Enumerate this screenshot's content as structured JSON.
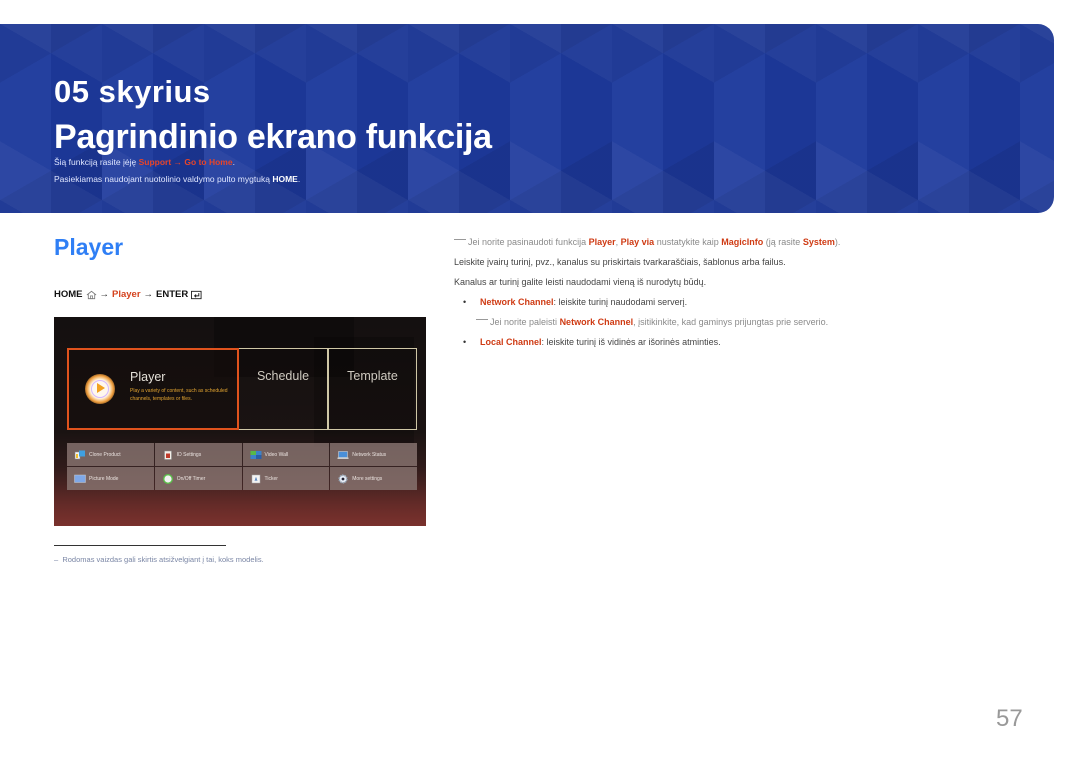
{
  "header": {
    "chapter": "05 skyrius",
    "title": "Pagrindinio ekrano funkcija",
    "location_prefix": "Šią funkciją rasite įėję",
    "location_menu1": "Support",
    "location_arrow": "→",
    "location_menu2": "Go to Home",
    "location_suffix": ".",
    "remote_prefix": "Pasiekiamas naudojant nuotolinio valdymo pulto mygtuką",
    "remote_button": "HOME",
    "remote_suffix": "."
  },
  "section": {
    "title": "Player",
    "path": {
      "home": "HOME",
      "home_icon": "home-icon",
      "arrow1": "→",
      "player": "Player",
      "arrow2": "→",
      "enter": "ENTER",
      "enter_icon": "enter-icon"
    }
  },
  "screen": {
    "tiles": [
      {
        "label": "Player",
        "desc": "Play a variety of content, such as scheduled channels, templates or files.",
        "icon": "play-icon",
        "selected": true
      },
      {
        "label": "Schedule"
      },
      {
        "label": "Template"
      }
    ],
    "grid": [
      {
        "label": "Clone Product",
        "icon": "clone-product-icon"
      },
      {
        "label": "ID Settings",
        "icon": "id-settings-icon"
      },
      {
        "label": "Video Wall",
        "icon": "video-wall-icon"
      },
      {
        "label": "Network Status",
        "icon": "network-status-icon"
      },
      {
        "label": "Picture Mode",
        "icon": "picture-mode-icon"
      },
      {
        "label": "On/Off Timer",
        "icon": "timer-icon"
      },
      {
        "label": "Ticker",
        "icon": "ticker-icon"
      },
      {
        "label": "More settings",
        "icon": "gear-icon"
      }
    ],
    "accent": "#e0531d"
  },
  "footnote": "Rodomas vaizdas gali skirtis atsižvelgiant į tai, koks modelis.",
  "right": {
    "note1": {
      "prefix": "Jei norite pasinaudoti funkcija",
      "k1": "Player",
      "sep": ",",
      "k2": "Play via",
      "mid": "nustatykite kaip",
      "k3": "MagicInfo",
      "paren_open": "(ją rasite",
      "k4": "System",
      "paren_close": ")."
    },
    "para1": "Leiskite įvairų turinį, pvz., kanalus su priskirtais tvarkaraščiais, šablonus arba failus.",
    "para2": "Kanalus ar turinį galite leisti naudodami vieną iš nurodytų būdų.",
    "bullets": [
      {
        "term": "Network Channel",
        "text": ": leiskite turinį naudodami serverį."
      },
      {
        "term": "Local Channel",
        "text": ": leiskite turinį iš vidinės ar išorinės atminties."
      }
    ],
    "note2": {
      "prefix": "Jei norite paleisti",
      "term": "Network Channel",
      "suffix": ", įsitikinkite, kad gaminys prijungtas prie serverio."
    }
  },
  "page_number": "57",
  "colors": {
    "header_blue": "#1d3a9c",
    "title_blue": "#2f7ff5",
    "accent_red": "#cf3b14"
  }
}
